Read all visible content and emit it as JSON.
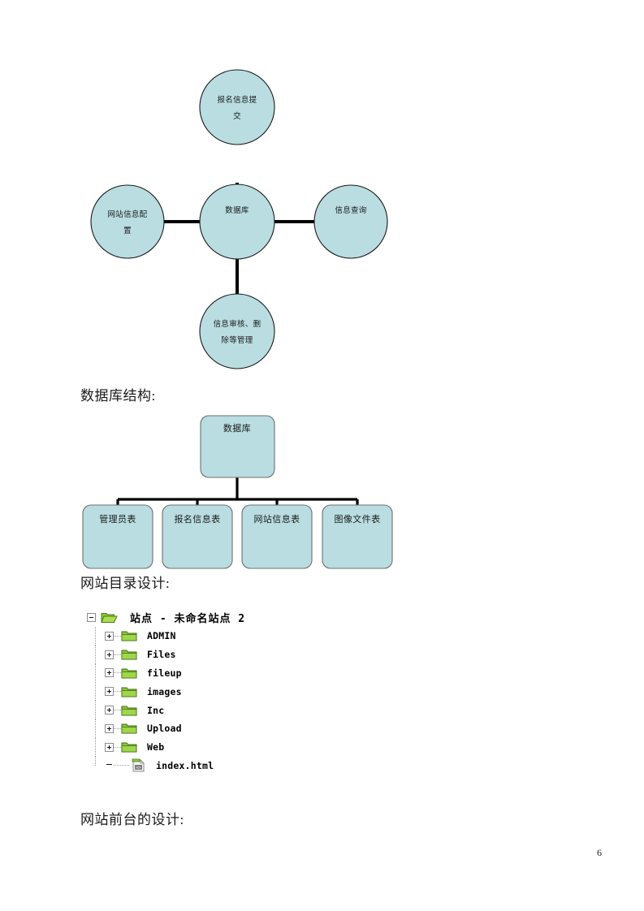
{
  "document": {
    "page_number": "6"
  },
  "headings": {
    "db_structure": "数据库结构:",
    "site_directory": "网站目录设计:",
    "frontend_design": "网站前台的设计:"
  },
  "colors": {
    "node_fill": "#b9dde1",
    "node_stroke": "#1b1b1b",
    "box_stroke": "#6f6f6f",
    "connector": "#000000",
    "folder": "#7cc13a",
    "text": "#1a1a1a"
  },
  "circle_diagram": {
    "center": {
      "label": "数据库"
    },
    "nodes": [
      {
        "id": "top",
        "label_line1": "报名信息提",
        "label_line2": "交"
      },
      {
        "id": "left",
        "label_line1": "网站信息配",
        "label_line2": "置"
      },
      {
        "id": "right",
        "label_line1": "信息查询",
        "label_line2": ""
      },
      {
        "id": "bottom",
        "label_line1": "信息审核、删",
        "label_line2": "除等管理"
      }
    ]
  },
  "db_structure_diagram": {
    "root": {
      "label": "数据库"
    },
    "children": [
      {
        "label": "管理员表"
      },
      {
        "label": "报名信息表"
      },
      {
        "label": "网站信息表"
      },
      {
        "label": "图像文件表"
      }
    ]
  },
  "folder_tree": {
    "root": {
      "label": "站点 - 未命名站点 2",
      "icon": "folder-open-icon",
      "expander": "minus"
    },
    "items": [
      {
        "label": "ADMIN",
        "icon": "folder-icon",
        "expander": "plus"
      },
      {
        "label": "Files",
        "icon": "folder-icon",
        "expander": "plus"
      },
      {
        "label": "fileup",
        "icon": "folder-icon",
        "expander": "plus"
      },
      {
        "label": "images",
        "icon": "folder-icon",
        "expander": "plus"
      },
      {
        "label": "Inc",
        "icon": "folder-icon",
        "expander": "plus"
      },
      {
        "label": "Upload",
        "icon": "folder-icon",
        "expander": "plus"
      },
      {
        "label": "Web",
        "icon": "folder-icon",
        "expander": "plus"
      },
      {
        "label": "index.html",
        "icon": "html-file-icon",
        "expander": "none"
      }
    ]
  }
}
